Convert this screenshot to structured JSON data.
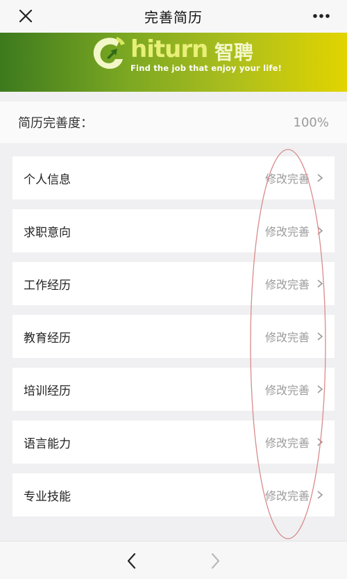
{
  "header": {
    "title": "完善简历",
    "close_icon": "close-icon",
    "more_icon": "more-icon"
  },
  "banner": {
    "brand": "hiturn",
    "brand_cn": "智聘",
    "tagline": "Find the job that enjoy your life!",
    "colors": {
      "start": "#3d7a1e",
      "end": "#e2d400"
    }
  },
  "completeness": {
    "label": "简历完善度：",
    "value": "100%"
  },
  "sections": [
    {
      "name": "个人信息",
      "action": "修改完善"
    },
    {
      "name": "求职意向",
      "action": "修改完善"
    },
    {
      "name": "工作经历",
      "action": "修改完善"
    },
    {
      "name": "教育经历",
      "action": "修改完善"
    },
    {
      "name": "培训经历",
      "action": "修改完善"
    },
    {
      "name": "语言能力",
      "action": "修改完善"
    },
    {
      "name": "专业技能",
      "action": "修改完善"
    }
  ],
  "annotation": {
    "color": "#d98a8a"
  },
  "bottom_nav": {
    "back_icon": "chevron-left-icon",
    "forward_icon": "chevron-right-icon"
  }
}
